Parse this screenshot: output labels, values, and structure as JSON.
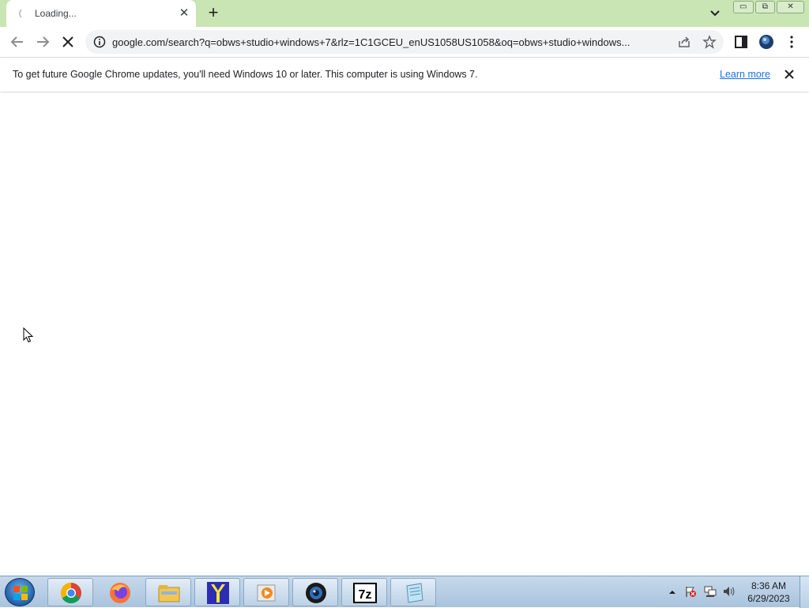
{
  "tab": {
    "title": "Loading...",
    "close": "✕"
  },
  "new_tab": "+",
  "window_buttons": {
    "minimize": "▭",
    "restore": "⧉",
    "close": "✕"
  },
  "omnibox": {
    "url": "google.com/search?q=obws+studio+windows+7&rlz=1C1GCEU_enUS1058US1058&oq=obws+studio+windows..."
  },
  "infobar": {
    "message": "To get future Google Chrome updates, you'll need Windows 10 or later. This computer is using Windows 7.",
    "learn_more": "Learn more"
  },
  "taskbar": {
    "apps": [
      "chrome-icon",
      "firefox-icon",
      "file-explorer-icon",
      "yandex-icon",
      "media-player-icon",
      "camera-app-icon",
      "7zip-icon",
      "notepad-icon"
    ],
    "app_7zip_label": "7z",
    "clock": {
      "time": "8:36 AM",
      "date": "6/29/2023"
    }
  },
  "colors": {
    "tab_strip": "#c9e5b4",
    "omnibox_bg": "#f1f3f4",
    "link": "#1a73e8",
    "taskbar": "#b5cce3"
  }
}
